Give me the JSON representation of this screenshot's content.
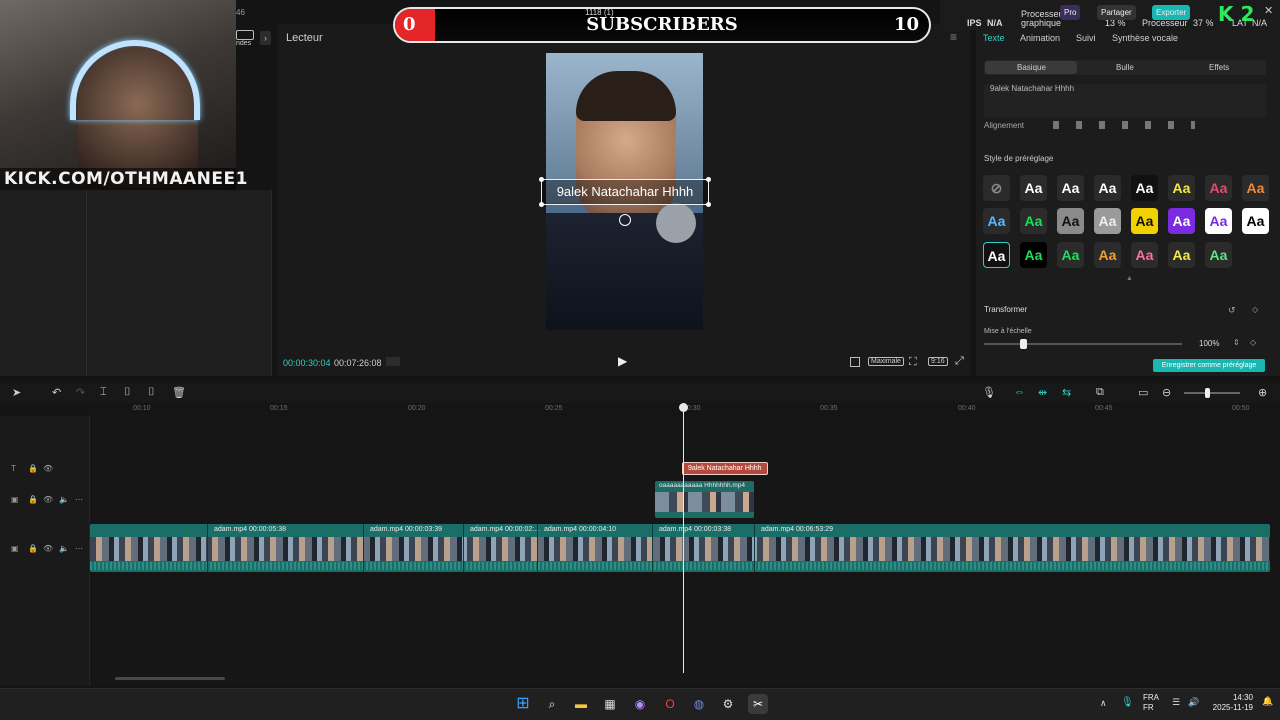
{
  "webcam": {
    "channel_url": "KICK.COM/OTHMAANEE1"
  },
  "left_panel": {
    "tab_partial": "ndes",
    "time_partial": "46"
  },
  "player": {
    "title": "Lecteur",
    "caption_text": "9alek Natachahar Hhhh",
    "current_time": "00:00:30:04",
    "total_time": "00:07:26:08",
    "controls": [
      "Maximale",
      "9:16"
    ]
  },
  "subscribers_overlay": {
    "left_value": "0",
    "title": "SUBSCRIBERS",
    "right_value": "10",
    "small_text": "1118 (1)",
    "progress_color": "#e52628"
  },
  "status": {
    "ips_label": "IPS",
    "ips_value": "N/A",
    "gpu_label": "Processeur graphique",
    "gpu_value": "13 %",
    "cpu_label": "Processeur",
    "cpu_value": "37 %",
    "lat_label": "LAT",
    "lat_value": "N/A",
    "pro_label": "Pro",
    "share_label": "Partager",
    "export_label": "Exporter",
    "k2_label": "K 2"
  },
  "right_panel": {
    "tabs": [
      "Texte",
      "Animation",
      "Suivi",
      "Synthèse vocale"
    ],
    "active_tab": "Texte",
    "segments": [
      "Basique",
      "Bulle",
      "Effets"
    ],
    "text_value": "9alek Natachahar Hhhh",
    "alignment_label": "Alignement",
    "preset_label": "Style de préréglage",
    "preset_symbol": "Aa",
    "transform_label": "Transformer",
    "scale_label": "Mise à l'échelle",
    "scale_value": "100%",
    "scale_fraction": 0.18,
    "save_preset_label": "Enregistrer comme préréglage",
    "accent_color": "#18b7b2"
  },
  "timeline": {
    "ruler_ticks": [
      "00:10",
      "00:15",
      "00:20",
      "00:25",
      "00:30",
      "00:35",
      "00:40",
      "00:45",
      "00:50"
    ],
    "text_clip": "9alek Natachahar Hhhh",
    "overlay_clip": "oaaaaaaaaaaa Hhhhhhh.mp4",
    "main_clips": [
      {
        "name": "adam.mp4",
        "duration": "00:00:05:38"
      },
      {
        "name": "adam.mp4",
        "duration": "00:00:03:39"
      },
      {
        "name": "adam.mp4",
        "duration": "00:00:02:..."
      },
      {
        "name": "adam.mp4",
        "duration": "00:00:04:10"
      },
      {
        "name": "adam.mp4",
        "duration": "00:00:03:38"
      },
      {
        "name": "adam.mp4",
        "duration": "00:06:53:29"
      }
    ]
  },
  "taskbar": {
    "lang_1": "FRA",
    "lang_2": "FR",
    "time": "14:30",
    "date": "2025-11-19"
  }
}
